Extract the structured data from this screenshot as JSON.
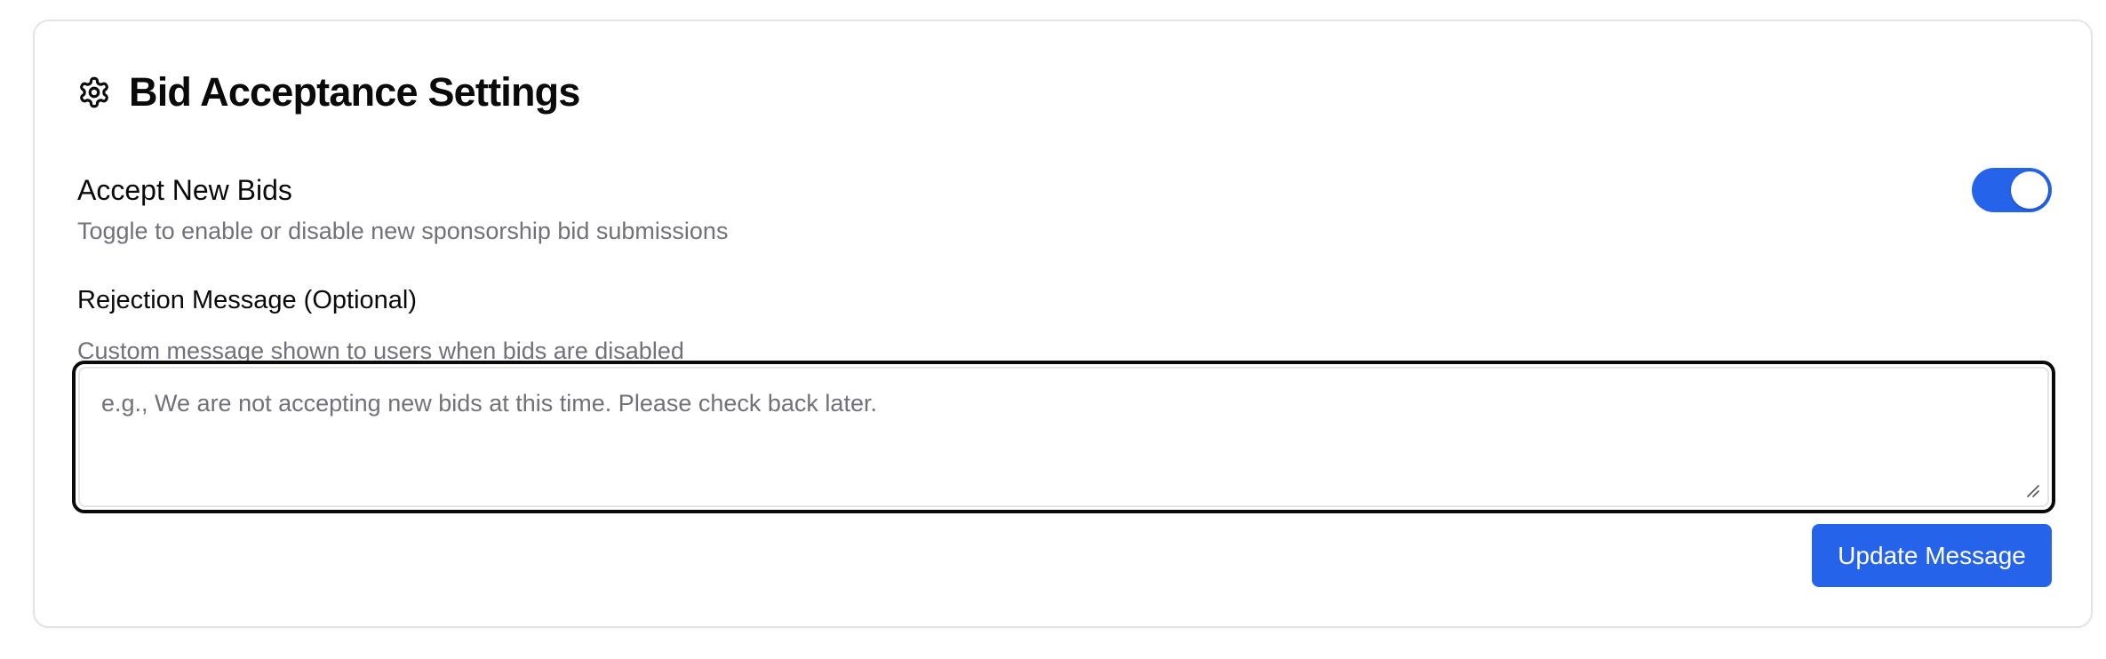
{
  "card": {
    "title": "Bid Acceptance Settings",
    "title_icon": "gear-icon"
  },
  "accept_bids": {
    "label": "Accept New Bids",
    "description": "Toggle to enable or disable new sponsorship bid submissions",
    "enabled": true
  },
  "rejection_message": {
    "label": "Rejection Message (Optional)",
    "description": "Custom message shown to users when bids are disabled",
    "value": "",
    "placeholder": "e.g., We are not accepting new bids at this time. Please check back later."
  },
  "update_button": {
    "label": "Update Message"
  },
  "colors": {
    "accent": "#2563eb",
    "muted_text": "#71717a",
    "border": "#e4e4e7"
  }
}
